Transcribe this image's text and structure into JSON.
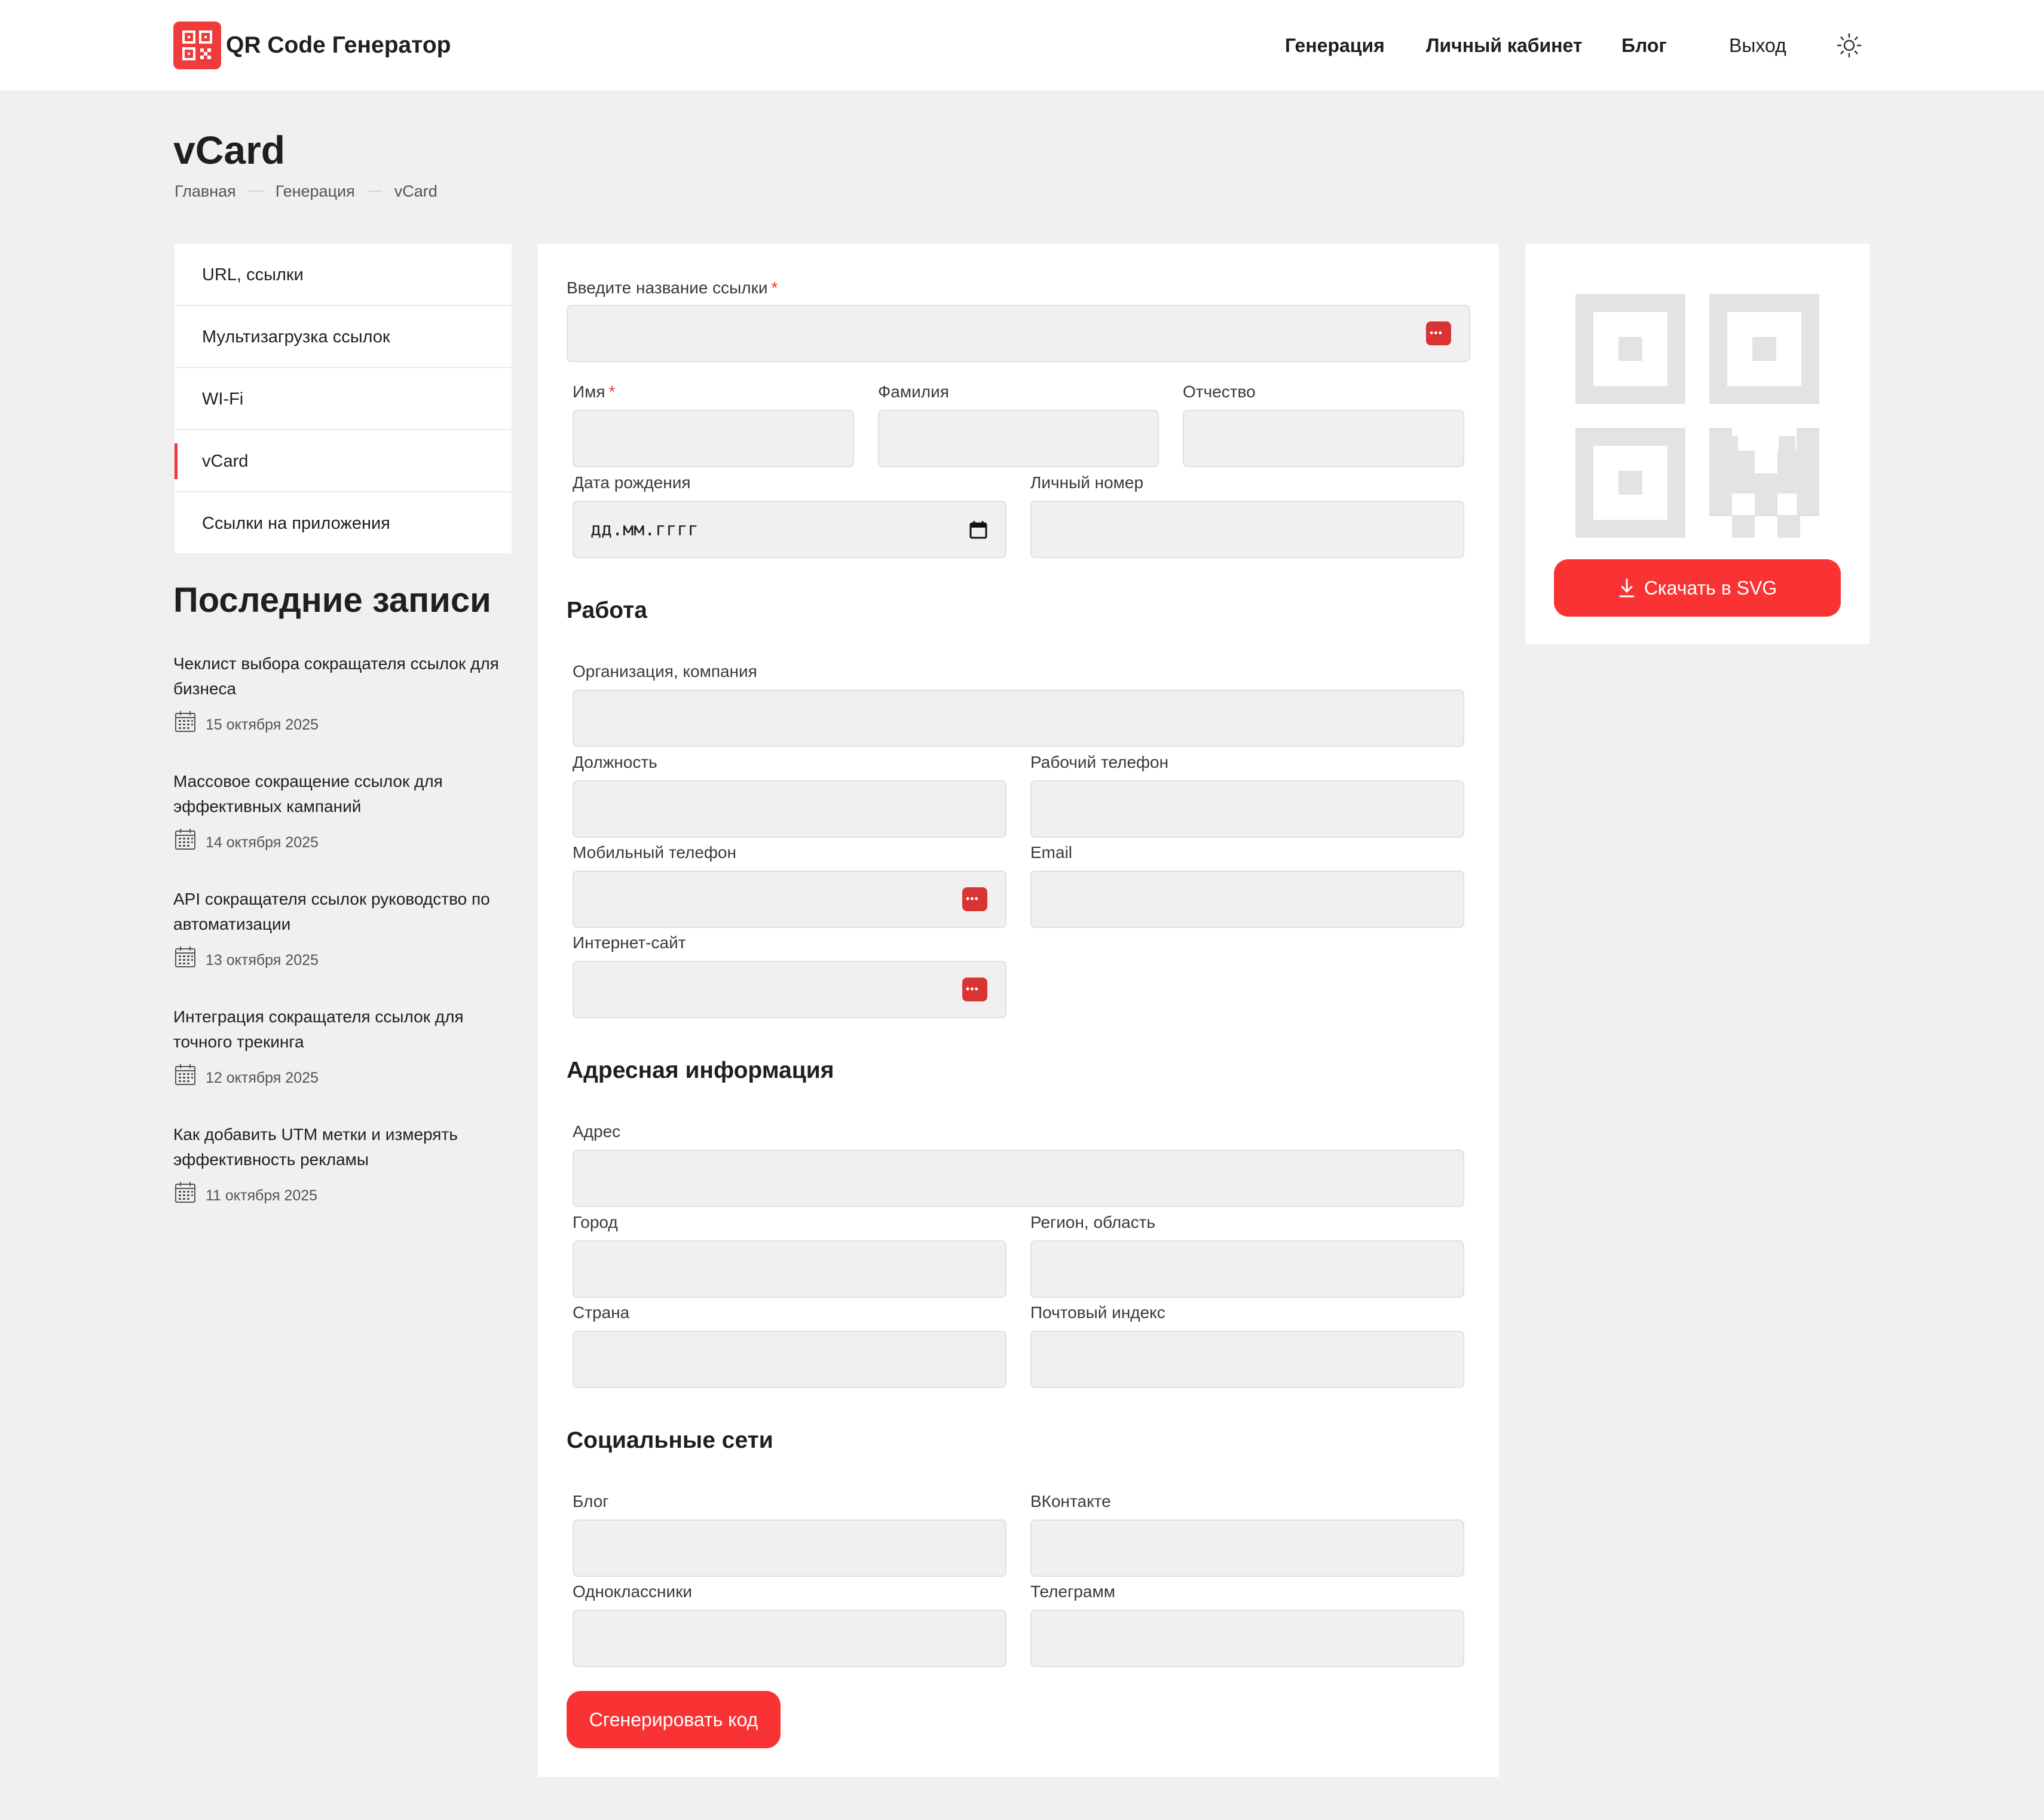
{
  "header": {
    "brand": "QR Code Генератор",
    "nav": [
      "Генерация",
      "Личный кабинет",
      "Блог",
      "Выход"
    ]
  },
  "page": {
    "title": "vCard",
    "breadcrumb": [
      "Главная",
      "Генерация",
      "vCard"
    ]
  },
  "sidebar": {
    "items": [
      "URL, ссылки",
      "Мультизагрузка ссылок",
      "WI-Fi",
      "vCard",
      "Ссылки на приложения"
    ],
    "active": "vCard"
  },
  "recent": {
    "title": "Последние записи",
    "posts": [
      {
        "title": "Чеклист выбора сокращателя ссылок для бизнеса",
        "date": "15 октября 2025"
      },
      {
        "title": "Массовое сокращение ссылок для эффективных кампаний",
        "date": "14 октября 2025"
      },
      {
        "title": "API сокращателя ссылок руководство по автоматизации",
        "date": "13 октября 2025"
      },
      {
        "title": "Интеграция сокращателя ссылок для точного трекинга",
        "date": "12 октября 2025"
      },
      {
        "title": "Как добавить UTM метки и измерять эффективность рекламы",
        "date": "11 октября 2025"
      }
    ]
  },
  "form": {
    "link_name_label": "Введите название ссылки",
    "first_name_label": "Имя",
    "last_name_label": "Фамилия",
    "middle_name_label": "Отчество",
    "birthdate_label": "Дата рождения",
    "birthdate_value": "дд.мм.гггг",
    "personal_phone_label": "Личный номер",
    "work_section": "Работа",
    "org_label": "Организация, компания",
    "position_label": "Должность",
    "work_phone_label": "Рабочий телефон",
    "mobile_label": "Мобильный телефон",
    "email_label": "Email",
    "website_label": "Интернет-сайт",
    "address_section": "Адресная информация",
    "address_label": "Адрес",
    "city_label": "Город",
    "region_label": "Регион, область",
    "country_label": "Страна",
    "zip_label": "Почтовый индекс",
    "social_section": "Социальные сети",
    "blog_label": "Блог",
    "vk_label": "ВКонтакте",
    "ok_label": "Одноклассники",
    "telegram_label": "Телеграмм",
    "required_mark": "*",
    "submit_label": "Сгенерировать код"
  },
  "qr": {
    "download_label": "Скачать в SVG"
  },
  "colors": {
    "accent": "#f93333",
    "background": "#f0f0f0",
    "qr_placeholder": "#e3e3e3"
  }
}
